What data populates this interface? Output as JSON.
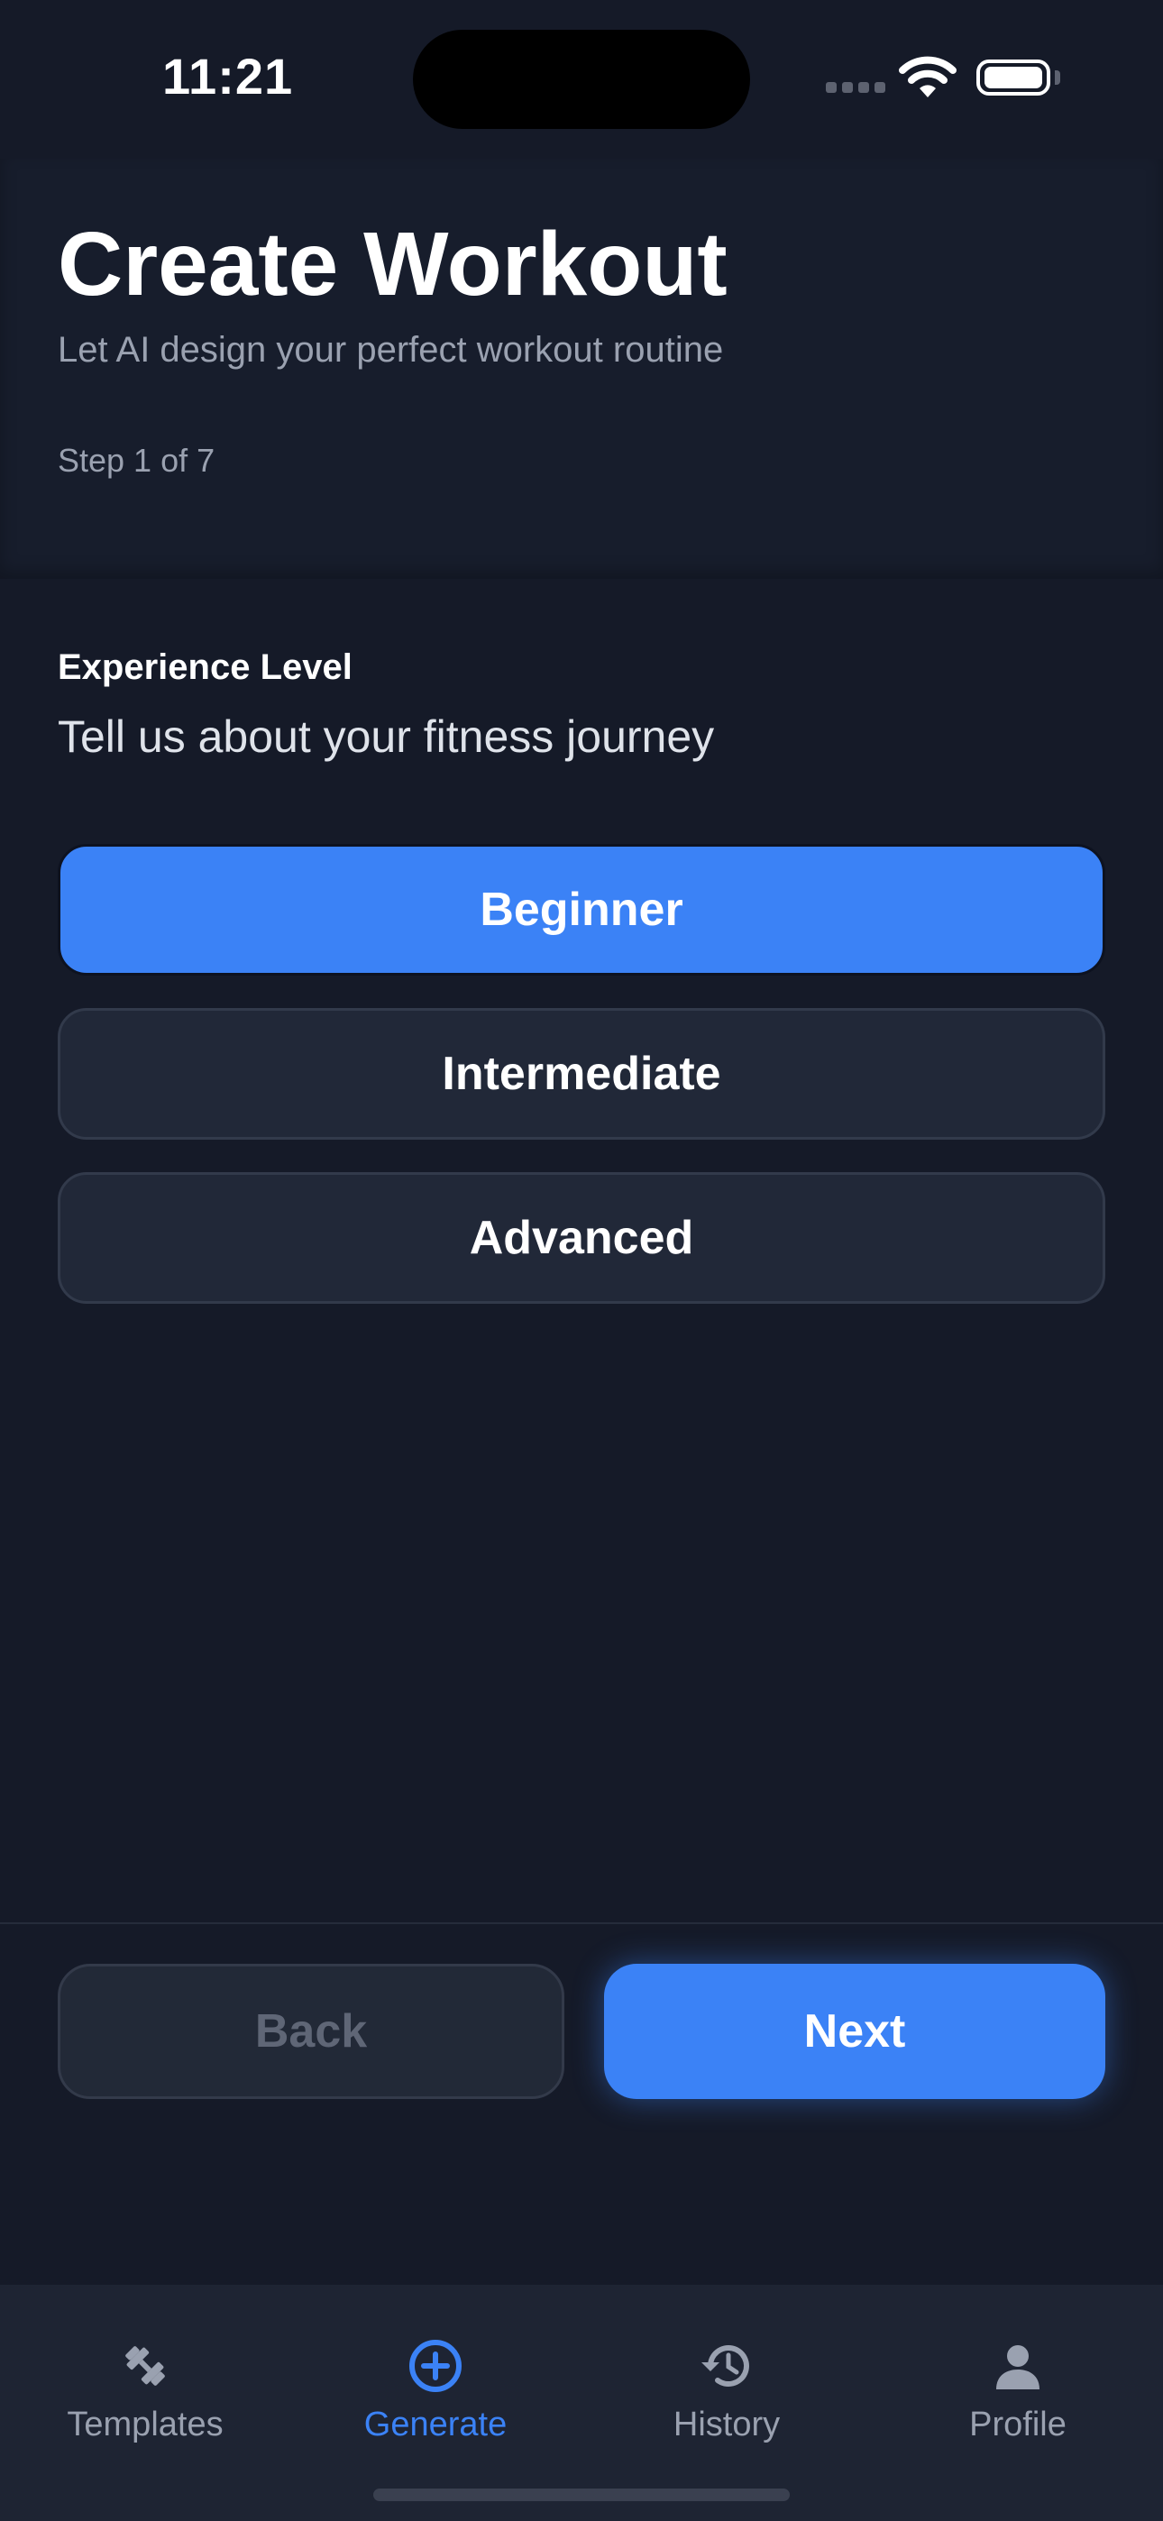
{
  "status_bar": {
    "time": "11:21"
  },
  "header": {
    "title": "Create Workout",
    "subtitle": "Let AI design your perfect workout routine",
    "step": "Step 1 of 7"
  },
  "question": {
    "label": "Experience Level",
    "prompt": "Tell us about your fitness journey",
    "options": [
      {
        "label": "Beginner",
        "selected": true
      },
      {
        "label": "Intermediate",
        "selected": false
      },
      {
        "label": "Advanced",
        "selected": false
      }
    ]
  },
  "navigation": {
    "back_label": "Back",
    "next_label": "Next"
  },
  "tab_bar": {
    "tabs": [
      {
        "label": "Templates",
        "icon": "dumbbell-icon",
        "active": false
      },
      {
        "label": "Generate",
        "icon": "plus-circle-icon",
        "active": true
      },
      {
        "label": "History",
        "icon": "history-icon",
        "active": false
      },
      {
        "label": "Profile",
        "icon": "person-icon",
        "active": false
      }
    ]
  },
  "colors": {
    "accent": "#3b82f6",
    "background": "#151a28",
    "surface": "#212838",
    "muted_text": "#9aa1b0"
  }
}
